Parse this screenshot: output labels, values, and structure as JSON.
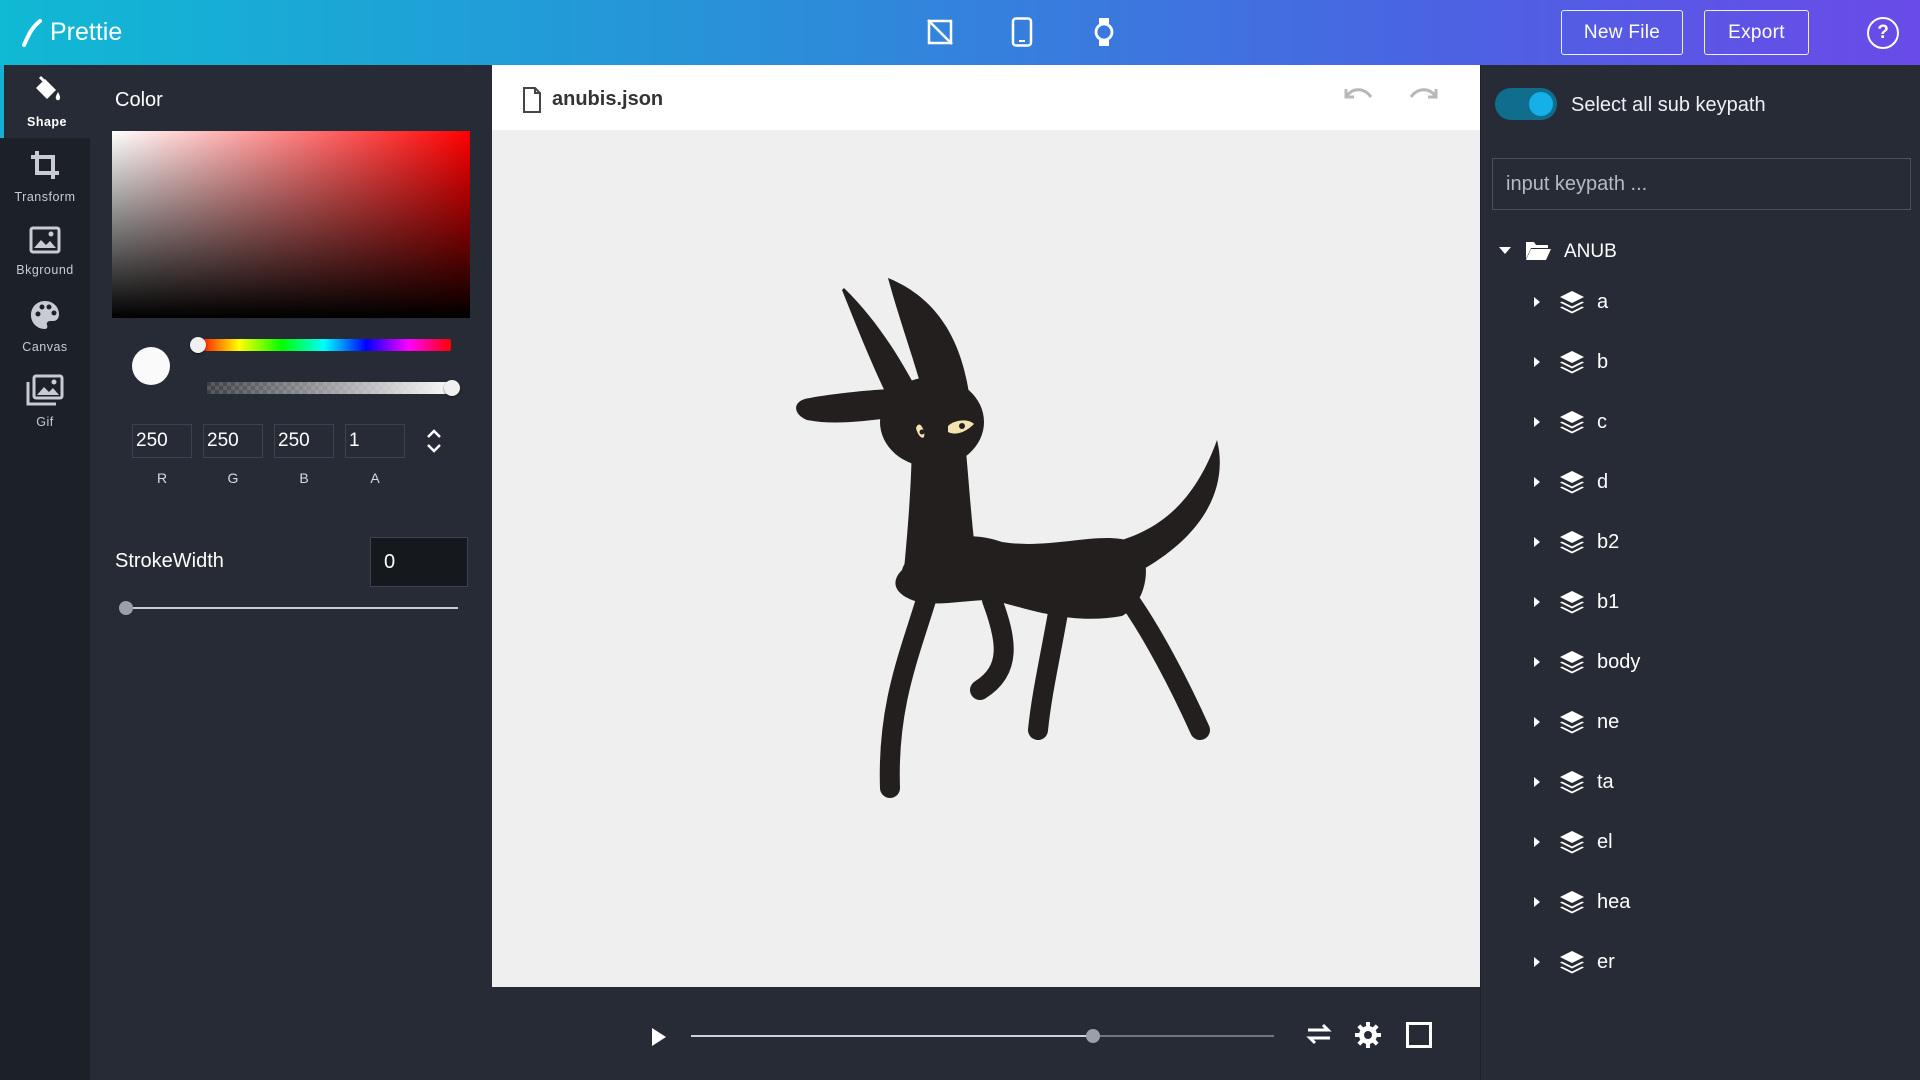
{
  "app": {
    "name": "Prettie"
  },
  "topbar": {
    "device_icons": [
      "no-device-icon",
      "phone-icon",
      "watch-icon"
    ],
    "new_file_label": "New File",
    "export_label": "Export",
    "help_label": "?"
  },
  "rail": {
    "items": [
      {
        "label": "Shape",
        "icon": "paint-bucket-icon",
        "active": true
      },
      {
        "label": "Transform",
        "icon": "crop-icon",
        "active": false
      },
      {
        "label": "Bkground",
        "icon": "image-icon",
        "active": false
      },
      {
        "label": "Canvas",
        "icon": "palette-icon",
        "active": false
      },
      {
        "label": "Gif",
        "icon": "images-icon",
        "active": false
      }
    ]
  },
  "properties": {
    "color_title": "Color",
    "r": "250",
    "g": "250",
    "b": "250",
    "a": "1",
    "r_label": "R",
    "g_label": "G",
    "b_label": "B",
    "a_label": "A",
    "stroke_title": "StrokeWidth",
    "stroke_value": "0",
    "stroke_level": 0,
    "hue_level": 0,
    "alpha_level": 1
  },
  "editor": {
    "file_name": "anubis.json"
  },
  "player": {
    "progress": 0.69
  },
  "layers": {
    "toggle_label": "Select all sub keypath",
    "toggle_on": true,
    "input_placeholder": "input keypath ...",
    "root": "ANUB",
    "items": [
      "a",
      "b",
      "c",
      "d",
      "b2",
      "b1",
      "body",
      "ne",
      "ta",
      "el",
      "hea",
      "er"
    ]
  },
  "colors": {
    "accent": "#16b0d6",
    "figure": "#231f1e",
    "figure_eye": "#f3e3ae"
  }
}
